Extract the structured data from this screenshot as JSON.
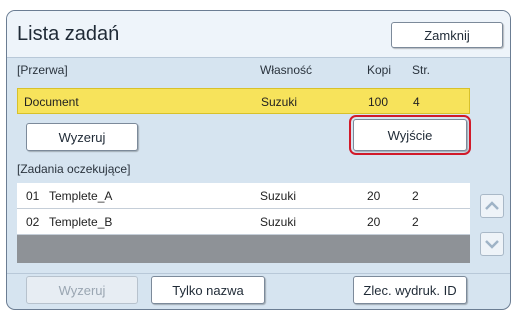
{
  "window": {
    "title": "Lista zadań",
    "close_label": "Zamknij"
  },
  "interrupted": {
    "section_label": "[Przerwa]",
    "columns": {
      "owner": "Własność",
      "copies": "Kopi",
      "pages": "Str."
    },
    "job": {
      "name": "Document",
      "owner": "Suzuki",
      "copies": "100",
      "pages": "4"
    },
    "reset_label": "Wyzeruj",
    "exit_label": "Wyjście"
  },
  "waiting": {
    "section_label": "[Zadania oczekujące]",
    "rows": [
      {
        "num": "01",
        "name": "Templete_A",
        "owner": "Suzuki",
        "copies": "20",
        "pages": "2"
      },
      {
        "num": "02",
        "name": "Templete_B",
        "owner": "Suzuki",
        "copies": "20",
        "pages": "2"
      }
    ]
  },
  "footer": {
    "reset_label": "Wyzeruj",
    "name_only_label": "Tylko nazwa",
    "id_print_label": "Zlec. wydruk. ID"
  },
  "colors": {
    "highlight": "#f7e35b",
    "panel": "#d6e4f0",
    "callout": "#d11a2a"
  }
}
